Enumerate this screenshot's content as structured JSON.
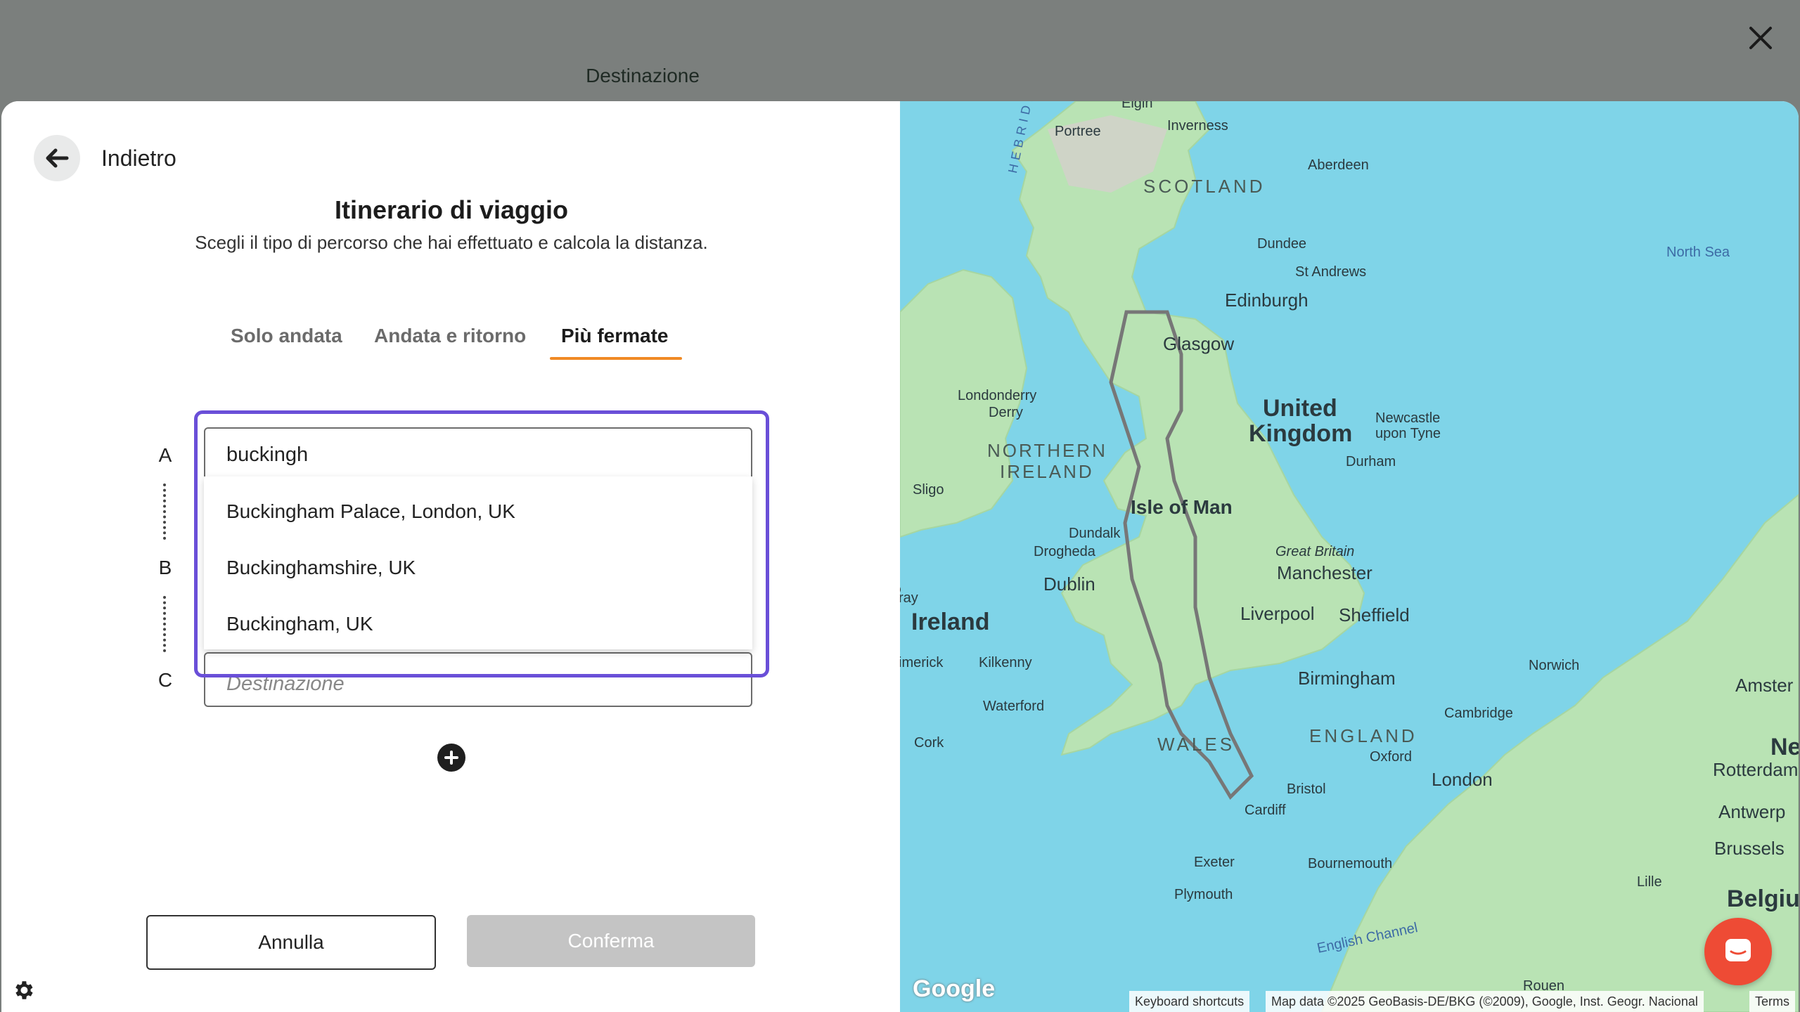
{
  "header": {
    "title": "Destinazione",
    "close_icon": "close-icon"
  },
  "back": {
    "label": "Indietro",
    "icon": "arrow-left-icon"
  },
  "page": {
    "title": "Itinerario di viaggio",
    "subtitle": "Scegli il tipo di percorso che hai effettuato e calcola la distanza."
  },
  "tabs": [
    {
      "label": "Solo andata",
      "active": false
    },
    {
      "label": "Andata e ritorno",
      "active": false
    },
    {
      "label": "Più fermate",
      "active": true
    }
  ],
  "stops": {
    "letters": [
      "A",
      "B",
      "C"
    ],
    "a_value": "buckingh",
    "c_placeholder": "Destinazione"
  },
  "suggestions": [
    "Buckingham Palace, London, UK",
    "Buckinghamshire, UK",
    "Buckingham, UK"
  ],
  "actions": {
    "cancel": "Annulla",
    "confirm": "Conferma"
  },
  "colors": {
    "accent": "#f08a24",
    "focus": "#6a4fd8",
    "confirm_disabled": "#c4c4c4",
    "chat": "#ee4b35"
  },
  "map": {
    "labels": {
      "elgin": "Elgin",
      "portree": "Portree",
      "inverness": "Inverness",
      "aberdeen": "Aberdeen",
      "scotland": "SCOTLAND",
      "hebrides": "HEBRIDES",
      "dundee": "Dundee",
      "st_andrews": "St Andrews",
      "edinburgh": "Edinburgh",
      "glasgow": "Glasgow",
      "north_sea": "North Sea",
      "londonderry": "Londonderry",
      "derry": "Derry",
      "northern": "NORTHERN",
      "ireland_ni": "IRELAND",
      "united": "United",
      "kingdom": "Kingdom",
      "newcastle": "Newcastle",
      "upon_tyne": "upon Tyne",
      "durham": "Durham",
      "sligo": "Sligo",
      "isle_of_man": "Isle of Man",
      "dundalk": "Dundalk",
      "drogheda": "Drogheda",
      "great_britain": "Great Britain",
      "manchester": "Manchester",
      "dublin": "Dublin",
      "ray": "ray",
      "ireland": "Ireland",
      "liverpool": "Liverpool",
      "sheffield": "Sheffield",
      "limerick": "imerick",
      "kilkenny": "Kilkenny",
      "norwich": "Norwich",
      "birmingham": "Birmingham",
      "amster": "Amster",
      "waterford": "Waterford",
      "cambridge": "Cambridge",
      "wales": "WALES",
      "england": "ENGLAND",
      "cork": "Cork",
      "ne": "Ne",
      "rotterdam": "Rotterdam",
      "oxford": "Oxford",
      "london": "London",
      "bristol": "Bristol",
      "antwerp": "Antwerp",
      "cardiff": "Cardiff",
      "brussels": "Brussels",
      "exeter": "Exeter",
      "bournemouth": "Bournemouth",
      "lille": "Lille",
      "belgiu": "Belgiu",
      "plymouth": "Plymouth",
      "english_channel": "English Channel",
      "rouen": "Rouen"
    },
    "google": "Google",
    "footer_shortcuts": "Keyboard shortcuts",
    "footer_data": "Map data ©2025 GeoBasis-DE/BKG (©2009), Google, Inst. Geogr. Nacional",
    "footer_terms": "Terms"
  }
}
